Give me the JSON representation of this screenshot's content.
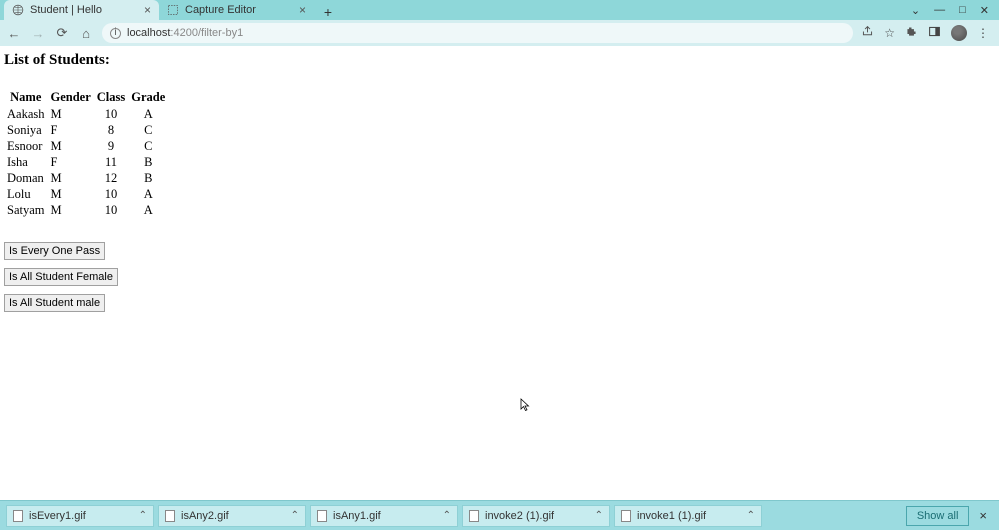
{
  "tabs": [
    {
      "title": "Student | Hello",
      "active": true
    },
    {
      "title": "Capture Editor",
      "active": false
    }
  ],
  "url": {
    "host": "localhost",
    "port": ":4200",
    "path": "/filter-by1"
  },
  "page": {
    "heading": "List of Students:",
    "columns": [
      "Name",
      "Gender",
      "Class",
      "Grade"
    ],
    "rows": [
      {
        "name": "Aakash",
        "gender": "M",
        "class": "10",
        "grade": "A"
      },
      {
        "name": "Soniya",
        "gender": "F",
        "class": "8",
        "grade": "C"
      },
      {
        "name": "Esnoor",
        "gender": "M",
        "class": "9",
        "grade": "C"
      },
      {
        "name": "Isha",
        "gender": "F",
        "class": "11",
        "grade": "B"
      },
      {
        "name": "Doman",
        "gender": "M",
        "class": "12",
        "grade": "B"
      },
      {
        "name": "Lolu",
        "gender": "M",
        "class": "10",
        "grade": "A"
      },
      {
        "name": "Satyam",
        "gender": "M",
        "class": "10",
        "grade": "A"
      }
    ],
    "buttons": {
      "every_pass": "Is Every One Pass",
      "all_female": "Is All Student Female",
      "all_male": "Is All Student male"
    }
  },
  "downloads": {
    "items": [
      {
        "name": "isEvery1.gif"
      },
      {
        "name": "isAny2.gif"
      },
      {
        "name": "isAny1.gif"
      },
      {
        "name": "invoke2 (1).gif"
      },
      {
        "name": "invoke1 (1).gif"
      }
    ],
    "show_all": "Show all"
  }
}
